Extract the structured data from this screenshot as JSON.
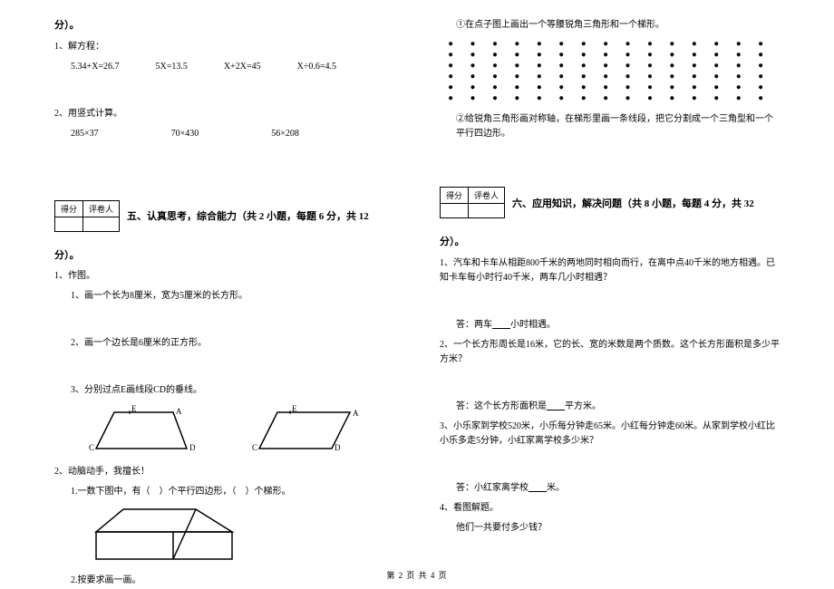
{
  "left": {
    "sec4_tail": "分）。",
    "q1_label": "1、解方程：",
    "q1_eq1": "5.34+X=26.7",
    "q1_eq2": "5X=13.5",
    "q1_eq3": "X+2X=45",
    "q1_eq4": "X÷0.6=4.5",
    "q2_label": "2、用竖式计算。",
    "q2_eq1": "285×37",
    "q2_eq2": "70×430",
    "q2_eq3": "56×208",
    "score_a": "得分",
    "score_b": "评卷人",
    "sec5_title": "五、认真思考，综合能力（共 2 小题，每题 6 分，共 12",
    "sec5_tail": "分）。",
    "s5q1": "1、作图。",
    "s5q1a": "1、画一个长为8厘米，宽为5厘米的长方形。",
    "s5q1b": "2、画一个边长是6厘米的正方形。",
    "s5q1c": "3、分别过点E画线段CD的垂线。",
    "lblA": "A",
    "lblE": "E",
    "lblC": "C",
    "lblD": "D",
    "s5q2": "2、动脑动手，我擅长！",
    "s5q2a_pre": "1.一数下图中，有（",
    "s5q2a_mid": "）个平行四边形，（",
    "s5q2a_end": "）个梯形。",
    "s5q2b": "2.按要求画一画。"
  },
  "right": {
    "dot_instr": "①在点子图上画出一个等腰锐角三角形和一个梯形。",
    "cut_instr": "②给锐角三角形画对称轴，在梯形里画一条线段，把它分割成一个三角型和一个平行四边形。",
    "score_a": "得分",
    "score_b": "评卷人",
    "sec6_title": "六、应用知识，解决问题（共 8 小题，每题 4 分，共 32",
    "sec6_tail": "分）。",
    "p1": "1、汽车和卡车从相距800千米的两地同时相向而行，在离中点40千米的地方相遇。已知卡车每小时行40千米，两车几小时相遇？",
    "p1_ans_pre": "答：两车",
    "p1_ans_blank": "____",
    "p1_ans_post": "小时相遇。",
    "p2": "2、一个长方形周长是16米，它的长、宽的米数是两个质数。这个长方形面积是多少平方米？",
    "p2_ans_pre": "答：这个长方形面积是",
    "p2_ans_blank": "____",
    "p2_ans_post": "平方米。",
    "p3": "3、小乐家到学校520米，小乐每分钟走65米。小红每分钟走60米。从家到学校小红比小乐多走5分钟，小红家离学校多少米？",
    "p3_ans_pre": "答：小红家离学校",
    "p3_ans_blank": "____",
    "p3_ans_post": "米。",
    "p4a": "4、看图解题。",
    "p4b": "他们一共要付多少钱？"
  },
  "footer": "第 2 页 共 4 页"
}
